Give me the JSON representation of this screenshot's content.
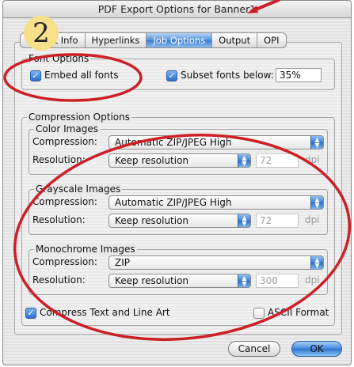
{
  "window": {
    "title": "PDF Export Options for Banner1"
  },
  "tabs": [
    {
      "label": "Layout Info",
      "active": false
    },
    {
      "label": "Hyperlinks",
      "active": false
    },
    {
      "label": "Job Options",
      "active": true
    },
    {
      "label": "Output",
      "active": false
    },
    {
      "label": "OPI",
      "active": false
    }
  ],
  "annotation": {
    "step_number": "2",
    "color": "#cc1f26",
    "badge_color": "#f6e08a"
  },
  "font_options": {
    "title": "Font Options",
    "embed_all": {
      "label": "Embed all fonts",
      "checked": true
    },
    "subset": {
      "label": "Subset fonts below:",
      "checked": true,
      "value": "35%"
    }
  },
  "compression": {
    "title": "Compression Options",
    "groups": [
      {
        "title": "Color Images",
        "compression_label": "Compression:",
        "compression_value": "Automatic ZIP/JPEG High",
        "resolution_label": "Resolution:",
        "resolution_value": "Keep resolution",
        "dpi_value": "72",
        "dpi_unit": "dpi"
      },
      {
        "title": "Grayscale Images",
        "compression_label": "Compression:",
        "compression_value": "Automatic ZIP/JPEG High",
        "resolution_label": "Resolution:",
        "resolution_value": "Keep resolution",
        "dpi_value": "72",
        "dpi_unit": "dpi"
      },
      {
        "title": "Monochrome Images",
        "compression_label": "Compression:",
        "compression_value": "ZIP",
        "resolution_label": "Resolution:",
        "resolution_value": "Keep resolution",
        "dpi_value": "300",
        "dpi_unit": "dpi"
      }
    ],
    "compress_text": {
      "label": "Compress Text and Line Art",
      "checked": true
    },
    "ascii_format": {
      "label": "ASCII Format",
      "checked": false
    }
  },
  "buttons": {
    "cancel": "Cancel",
    "ok": "OK"
  }
}
